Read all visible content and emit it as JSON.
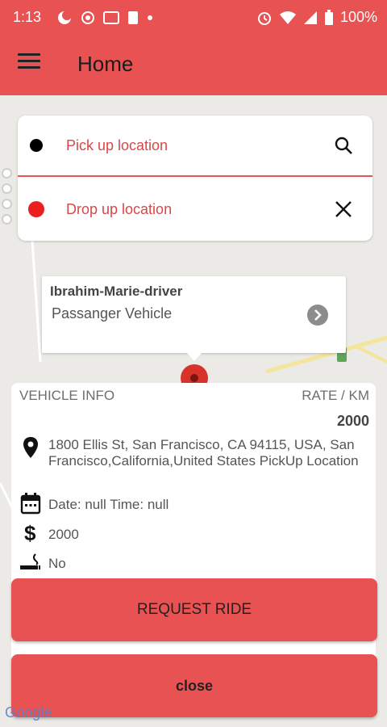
{
  "status_bar": {
    "time": "1:13",
    "battery": "100%"
  },
  "header": {
    "title": "Home"
  },
  "locations": {
    "pickup_label": "Pick up location",
    "dropoff_label": "Drop up location"
  },
  "driver_popup": {
    "name": "Ibrahim-Marie-driver",
    "vehicle_type": "Passanger Vehicle"
  },
  "vehicle_info": {
    "header": "VEHICLE INFO",
    "rate_label": "RATE / KM",
    "rate_value": "2000",
    "address": "1800 Ellis St, San Francisco, CA 94115, USA, San Francisco,California,United States PickUp Location",
    "datetime": "Date: null Time: null",
    "price": "2000",
    "smoking": "No"
  },
  "actions": {
    "request_label": "REQUEST RIDE",
    "close_label": "close"
  },
  "map": {
    "attribution": "Google"
  },
  "colors": {
    "primary": "#e85252",
    "pickup_dot": "#000000",
    "dropoff_dot": "#ec1f1f"
  }
}
